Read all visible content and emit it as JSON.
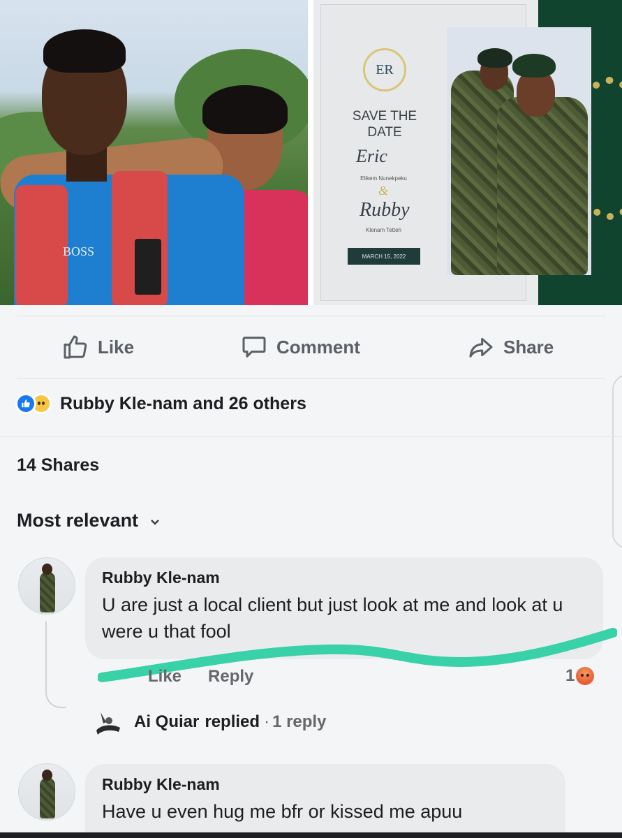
{
  "post_photos": {
    "left_shirt_text": "BOSS",
    "invite": {
      "monogram": "ER",
      "save_the_date": "SAVE THE DATE",
      "groom_script": "Eric",
      "groom_name": "Elikem Nunekpeku",
      "ampersand": "&",
      "bride_script": "Rubby",
      "bride_name": "Klenam Tetteh",
      "date": "MARCH 15, 2022"
    }
  },
  "actions": {
    "like": "Like",
    "comment": "Comment",
    "share": "Share"
  },
  "reactions": {
    "summary": "Rubby Kle-nam and 26 others",
    "types": [
      "like",
      "sad"
    ]
  },
  "shares": "14 Shares",
  "sort": {
    "label": "Most relevant"
  },
  "comments": [
    {
      "author": "Rubby Kle-nam",
      "text": "U are just a local client but just look at me and look at u were u that fool",
      "like_label": "Like",
      "reply_label": "Reply",
      "reaction_count": "1",
      "reaction_type": "angry",
      "highlight_color": "#39d1a7",
      "reply_summary": {
        "name": "Ai Quiar",
        "verb": "replied",
        "separator": "·",
        "count": "1 reply"
      }
    },
    {
      "author": "Rubby Kle-nam",
      "text": "Have u even hug me bfr or kissed me apuu"
    }
  ],
  "colors": {
    "facebook_blue": "#1877f2",
    "muted_text": "#65676b",
    "bubble_bg": "#eaebed"
  }
}
